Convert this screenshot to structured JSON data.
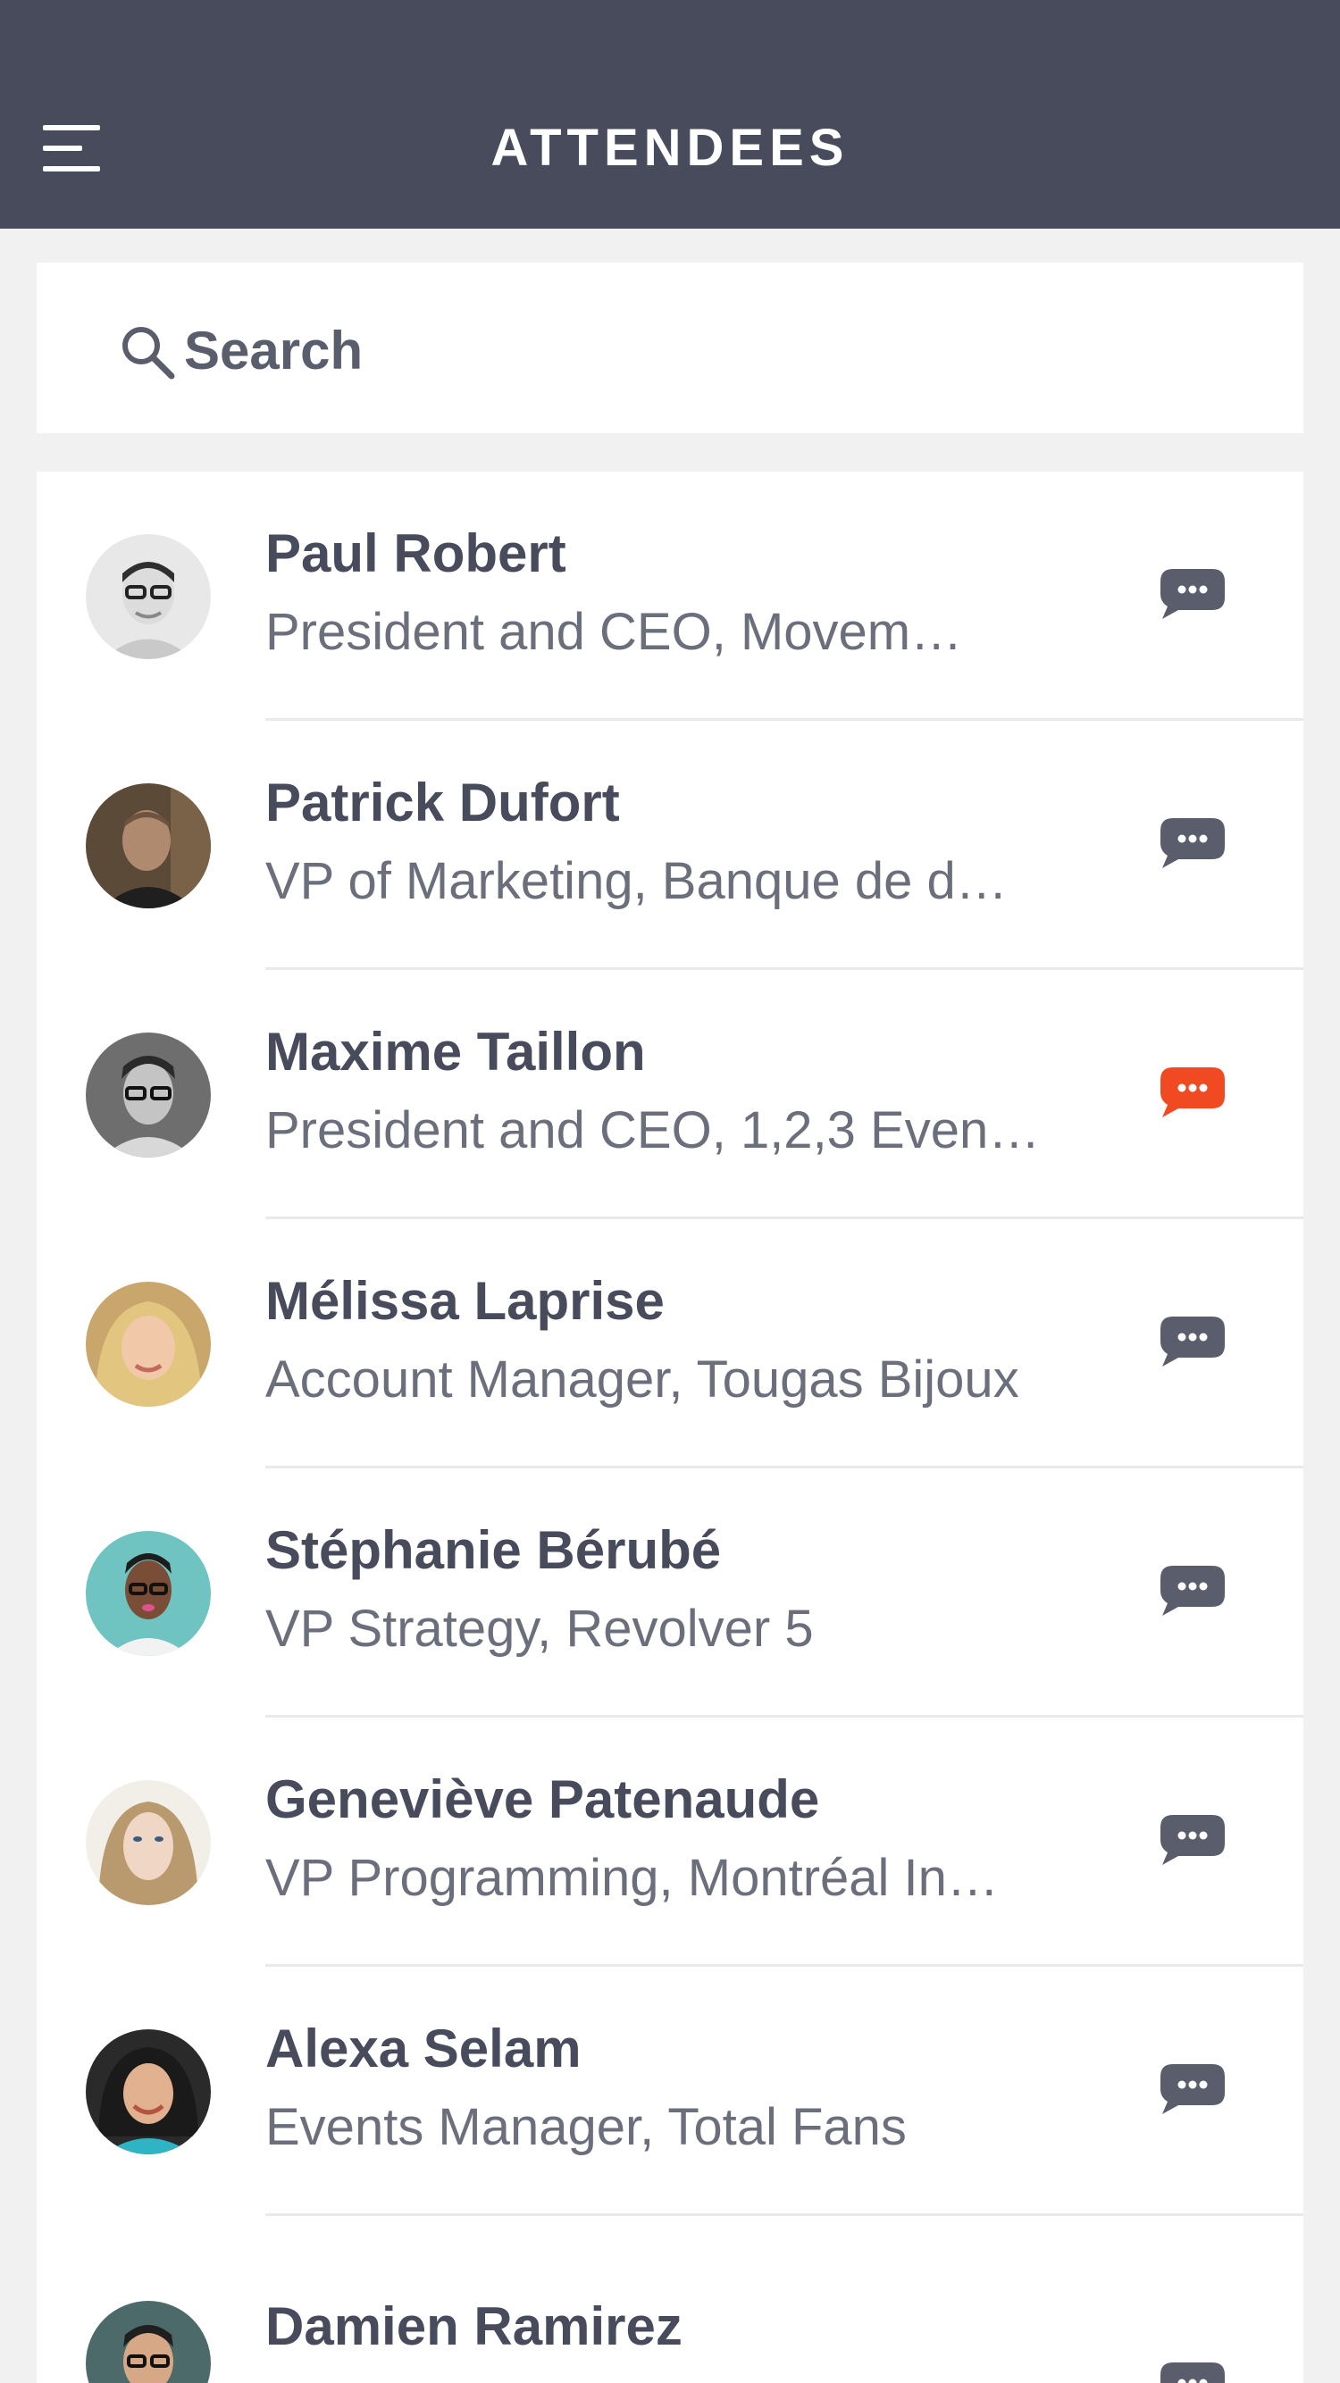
{
  "header": {
    "title": "ATTENDEES",
    "menu_icon": "hamburger-menu-icon",
    "background": "#474b5b"
  },
  "search": {
    "placeholder": "Search",
    "value": "",
    "icon": "search-icon"
  },
  "attendees": [
    {
      "name": "Paul Robert",
      "title": "President and CEO, Movem…",
      "chat_unread": false
    },
    {
      "name": "Patrick Dufort",
      "title": "VP of Marketing, Banque de d…",
      "chat_unread": false
    },
    {
      "name": "Maxime Taillon",
      "title": "President and CEO, 1,2,3 Even…",
      "chat_unread": true
    },
    {
      "name": "Mélissa Laprise",
      "title": "Account Manager, Tougas Bijoux",
      "chat_unread": false
    },
    {
      "name": "Stéphanie Bérubé",
      "title": "VP Strategy, Revolver 5",
      "chat_unread": false
    },
    {
      "name": "Geneviève Patenaude",
      "title": "VP Programming, Montréal In…",
      "chat_unread": false
    },
    {
      "name": "Alexa Selam",
      "title": "Events Manager, Total Fans",
      "chat_unread": false
    },
    {
      "name": "Damien Ramirez",
      "title": "",
      "chat_unread": false
    }
  ],
  "colors": {
    "chat_default": "#5a5e6c",
    "chat_unread": "#f04a23",
    "name_text": "#474b5b",
    "title_text": "#6b6f7c",
    "background": "#f1f1f2"
  }
}
